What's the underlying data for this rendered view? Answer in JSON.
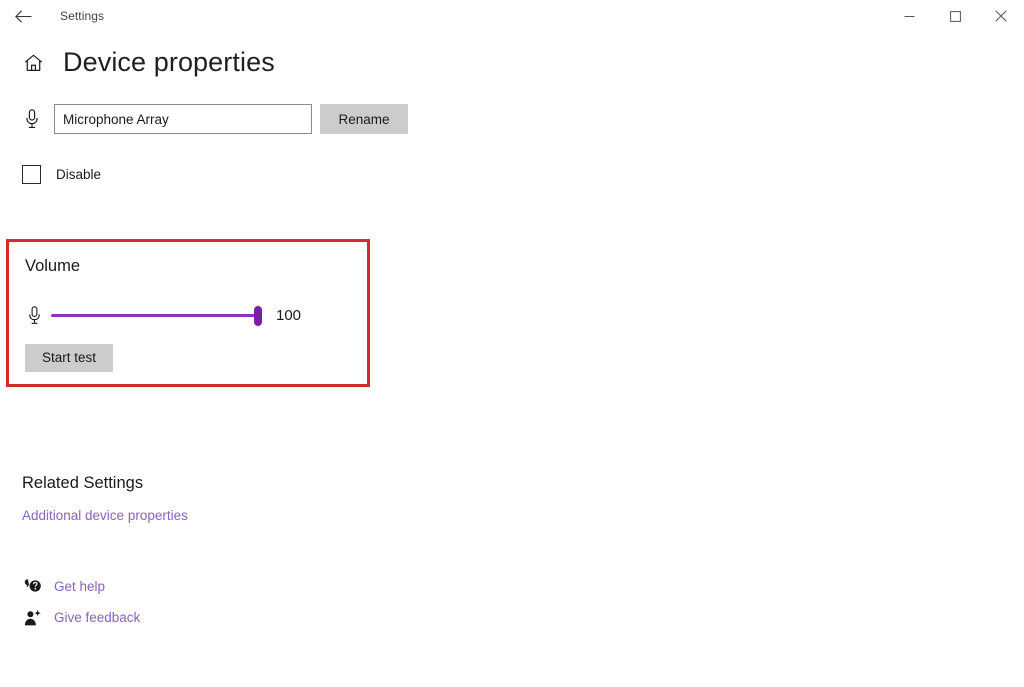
{
  "window": {
    "app_title": "Settings",
    "back_icon": "back-arrow-icon",
    "minimize_icon": "minimize-icon",
    "maximize_icon": "maximize-icon",
    "close_icon": "close-icon"
  },
  "header": {
    "home_icon": "home-icon",
    "title": "Device properties"
  },
  "device": {
    "mic_icon": "microphone-icon",
    "name_value": "Microphone Array",
    "name_placeholder": "Device name",
    "rename_label": "Rename",
    "disable_label": "Disable",
    "disable_checked": false
  },
  "volume": {
    "heading": "Volume",
    "mic_icon": "microphone-icon",
    "level": "100",
    "level_percent": 100,
    "min": 0,
    "max": 100,
    "start_test_label": "Start test",
    "annotation_color": "#d42a2a",
    "accent_color": "#7b1fa8"
  },
  "related": {
    "heading": "Related Settings",
    "additional_link": "Additional device properties"
  },
  "footer": {
    "links": [
      {
        "label": "Get help",
        "icon": "help-bubble-icon"
      },
      {
        "label": "Give feedback",
        "icon": "feedback-person-icon"
      }
    ]
  },
  "colors": {
    "link_purple": "#8764b8",
    "button_gray": "#cccccc",
    "annotation_red": "#d42a2a"
  }
}
